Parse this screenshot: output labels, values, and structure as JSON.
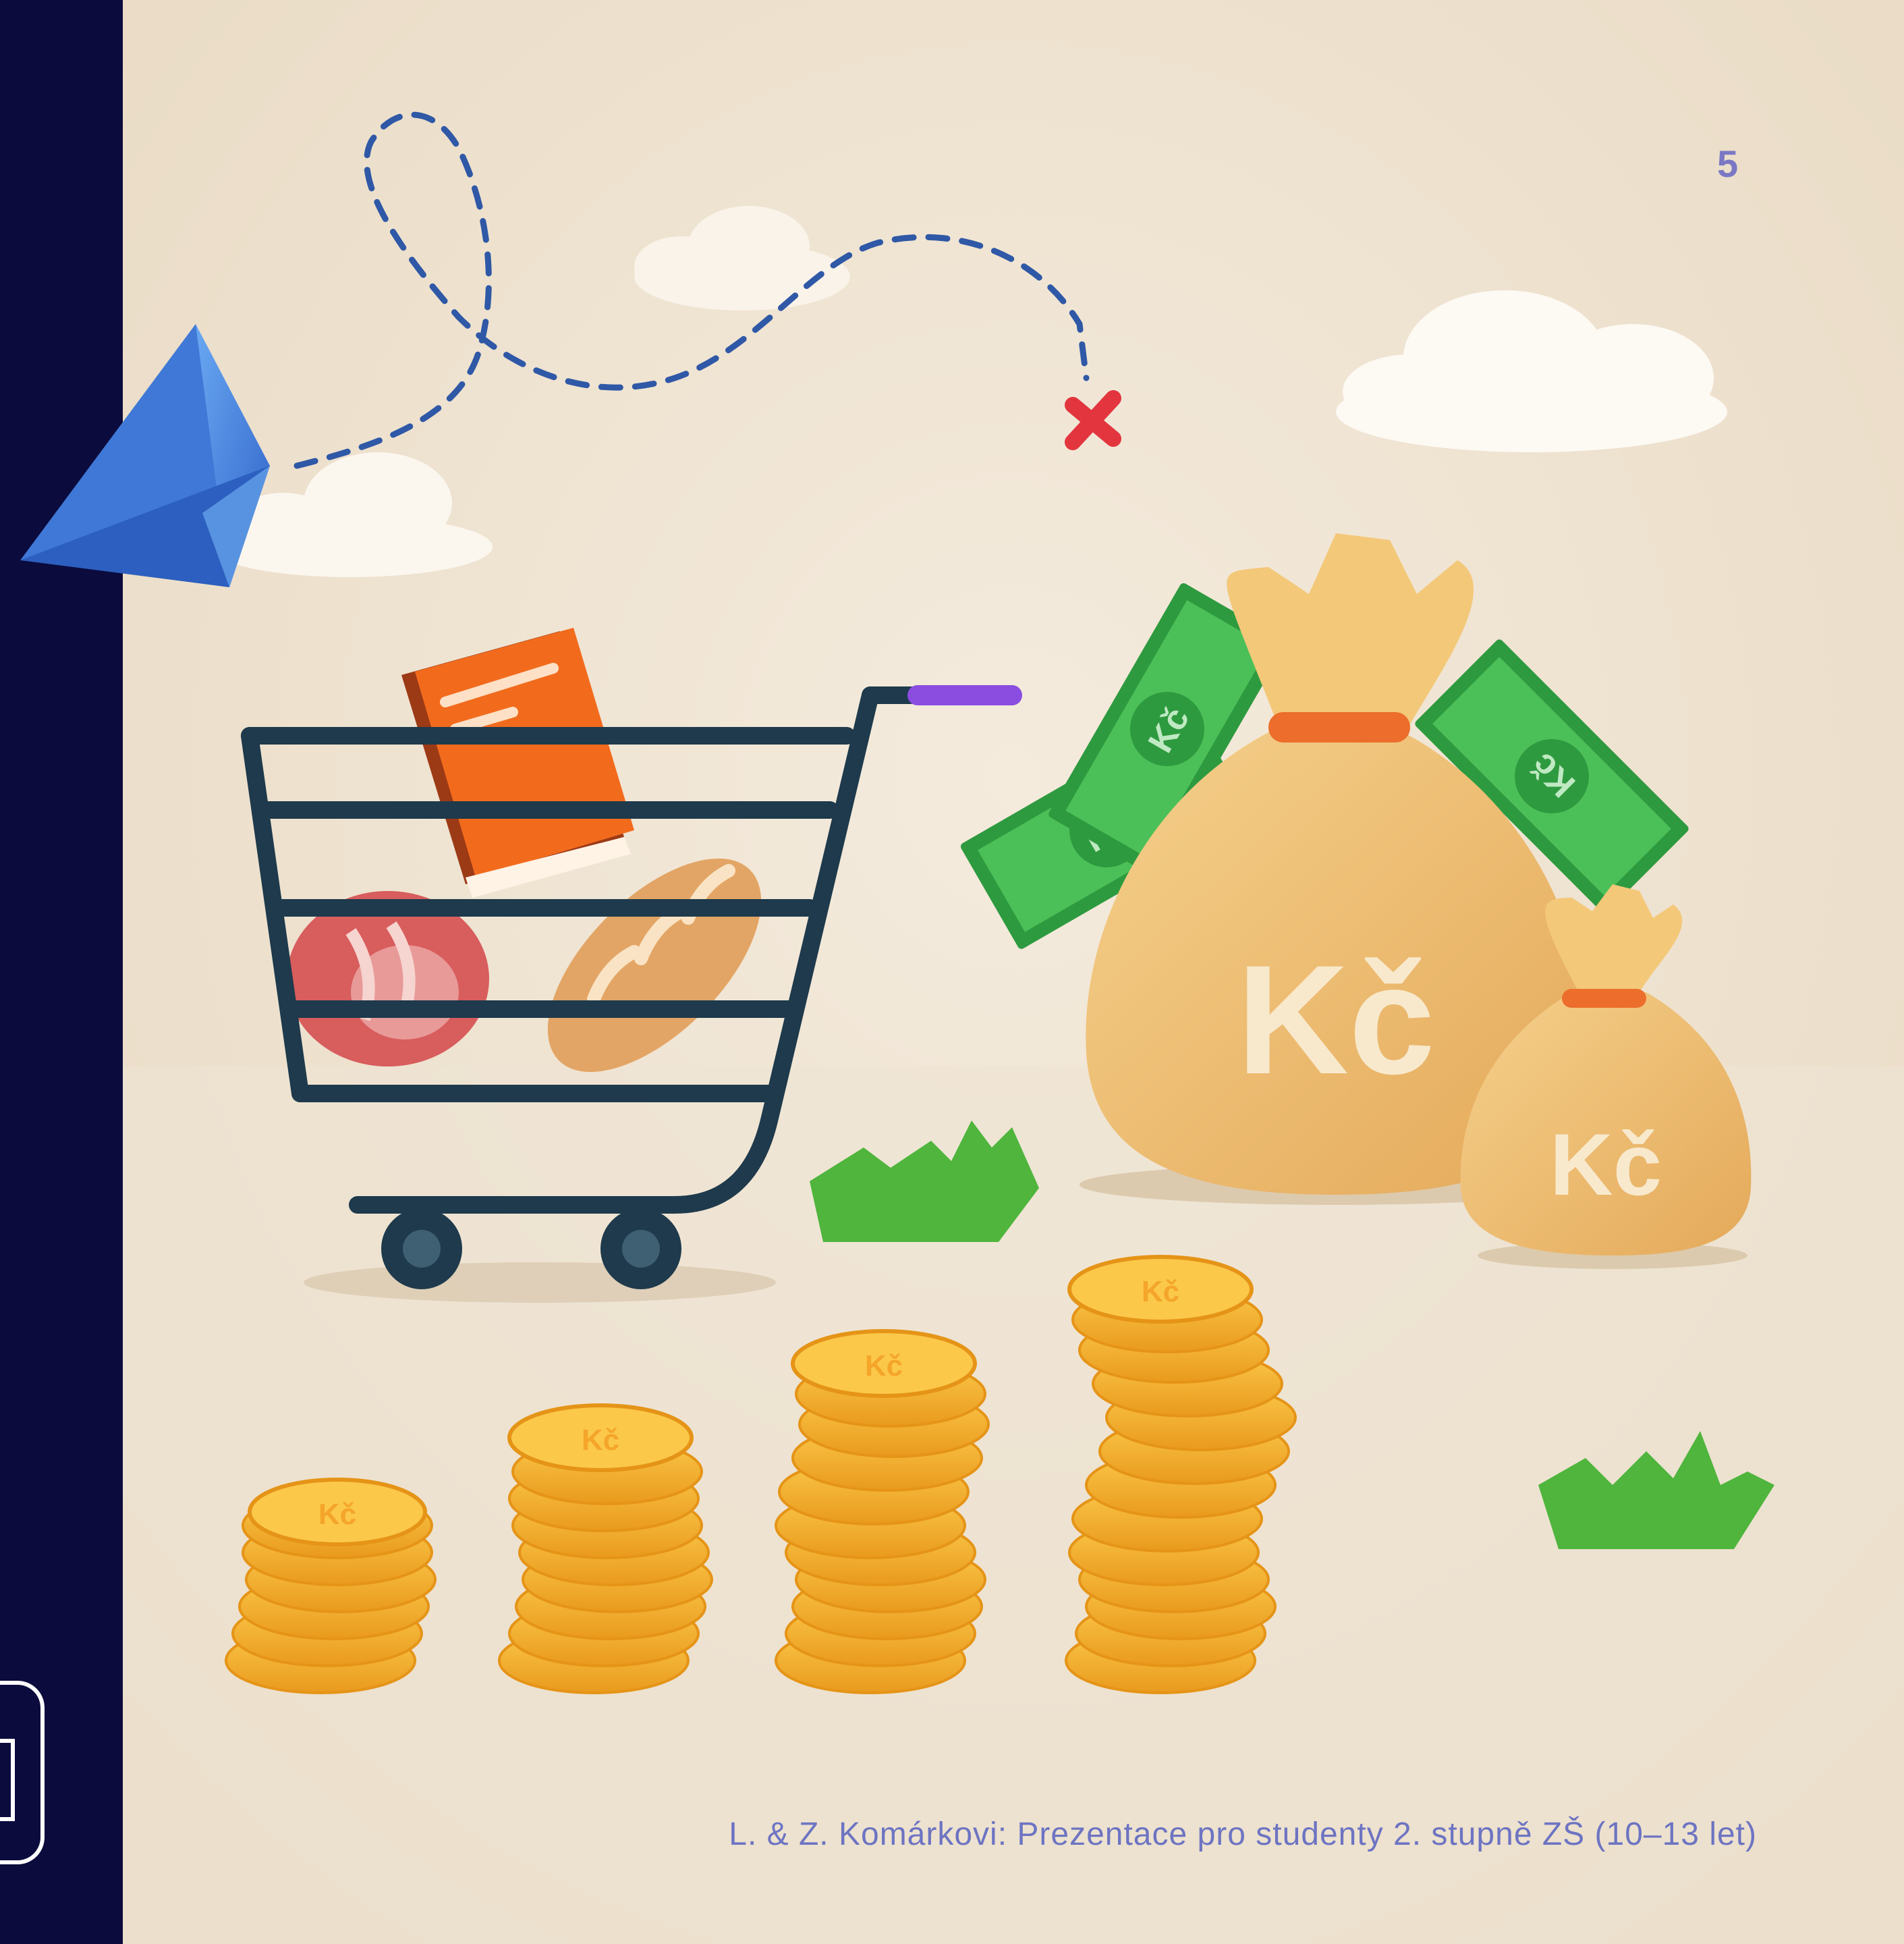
{
  "slide": {
    "page_number": "5",
    "footer": "L. & Z. Komárkovi: Prezentace pro studenty 2. stupně ZŠ (10–13 let)"
  },
  "illustration": {
    "bag_large_label": "Kč",
    "bag_small_label": "Kč",
    "banknote_label": "Kč",
    "coin_mark": "Kč"
  },
  "colors": {
    "sidebar": "#0b0b3d",
    "paper": "#f1e6d6",
    "accent_text": "#6d74c2",
    "cart": "#1e3a4c",
    "cart_handle": "#8a4de0",
    "coin": "#f6b32c",
    "bag": "#efc372",
    "banknote": "#3cb04a",
    "grass": "#4fb53d",
    "plane": "#4a86e0",
    "book": "#f26b1d"
  }
}
